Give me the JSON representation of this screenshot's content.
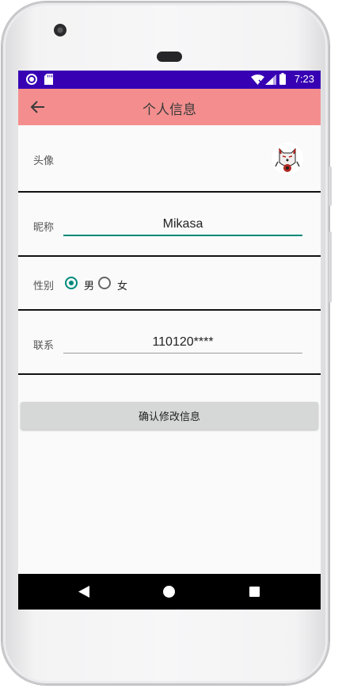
{
  "status_bar": {
    "time": "7:23",
    "icons": [
      "record-icon",
      "sd-card-icon",
      "wifi-icon",
      "signal-icon",
      "battery-icon"
    ],
    "bg_color": "#3700b3"
  },
  "app_bar": {
    "title": "个人信息",
    "bg_color": "#f48e8e",
    "back_icon": "arrow-back-icon"
  },
  "form": {
    "avatar": {
      "label": "头像",
      "icon": "avatar-image"
    },
    "nickname": {
      "label": "昵称",
      "value": "Mikasa"
    },
    "gender": {
      "label": "性别",
      "options": [
        {
          "label": "男",
          "checked": true
        },
        {
          "label": "女",
          "checked": false
        }
      ]
    },
    "contact": {
      "label": "联系",
      "value": "110120****"
    },
    "accent_color": "#00897b"
  },
  "confirm_button": {
    "label": "确认修改信息"
  },
  "nav_bar": {
    "buttons": [
      "back-triangle-icon",
      "home-circle-icon",
      "recents-square-icon"
    ]
  }
}
